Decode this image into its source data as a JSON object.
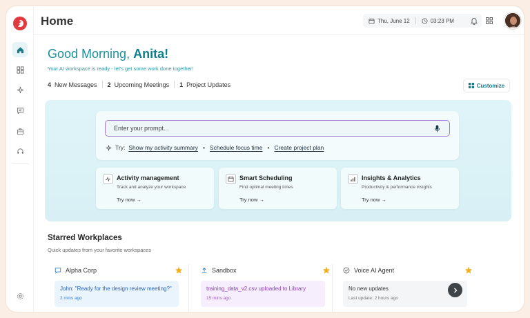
{
  "header": {
    "title": "Home",
    "date": "Thu, June 12",
    "time": "03:23 PM"
  },
  "sidebar": {
    "items": [
      {
        "name": "home",
        "icon": "home-icon",
        "active": true
      },
      {
        "name": "dashboard",
        "icon": "grid-icon"
      },
      {
        "name": "ai",
        "icon": "sparkle-icon"
      },
      {
        "name": "messages",
        "icon": "chat-icon"
      },
      {
        "name": "work",
        "icon": "briefcase-icon"
      },
      {
        "name": "support",
        "icon": "headset-icon"
      }
    ],
    "footer_icon": "settings-icon"
  },
  "greeting": {
    "prefix": "Good Morning,",
    "name": "Anita!",
    "subtitle": "Your AI workspace is ready - let's get some work done together!"
  },
  "stats": [
    {
      "count": "4",
      "label": "New Messages"
    },
    {
      "count": "2",
      "label": "Upcoming Meetings"
    },
    {
      "count": "1",
      "label": "Project Updates"
    }
  ],
  "customize_label": "Customize",
  "prompt": {
    "placeholder": "Enter your prompt...",
    "try_label": "Try:",
    "suggestions": [
      "Show my activity summary",
      "Schedule focus time",
      "Create project plan"
    ]
  },
  "features": [
    {
      "title": "Activity management",
      "desc": "Track and analyze your workspace",
      "cta": "Try now →",
      "icon": "activity-icon"
    },
    {
      "title": "Smart Scheduling",
      "desc": "Find optimal meeting times",
      "cta": "Try now →",
      "icon": "calendar-icon"
    },
    {
      "title": "Insights & Analytics",
      "desc": "Productivity & performance insights",
      "cta": "Try now →",
      "icon": "bar-chart-icon"
    }
  ],
  "starred": {
    "title": "Starred Workplaces",
    "subtitle": "Quick updates from your favorite workspaces",
    "cards": [
      {
        "name": "Alpha Corp",
        "icon": "chat-icon",
        "message": "John: \"Ready for the design review meeting?\"",
        "time": "2 mins ago",
        "bg": "#eaf4fc",
        "msg_color": "#2b63b5",
        "time_color": "#3b7ed0"
      },
      {
        "name": "Sandbox",
        "icon": "upload-icon",
        "message": "training_data_v2.csv uploaded to Library",
        "time": "15 mins ago",
        "bg": "#f6eefc",
        "msg_color": "#8a3fb3",
        "time_color": "#a05bc6"
      },
      {
        "name": "Voice AI Agent",
        "icon": "check-circle-icon",
        "message": "No new updates",
        "time": "Last update: 2 hours ago",
        "bg": "#f4f5f6",
        "msg_color": "#333333",
        "time_color": "#777777"
      }
    ]
  },
  "colors": {
    "accent": "#1b8a98",
    "brand": "#e03a3e",
    "star": "#f2b01e"
  }
}
